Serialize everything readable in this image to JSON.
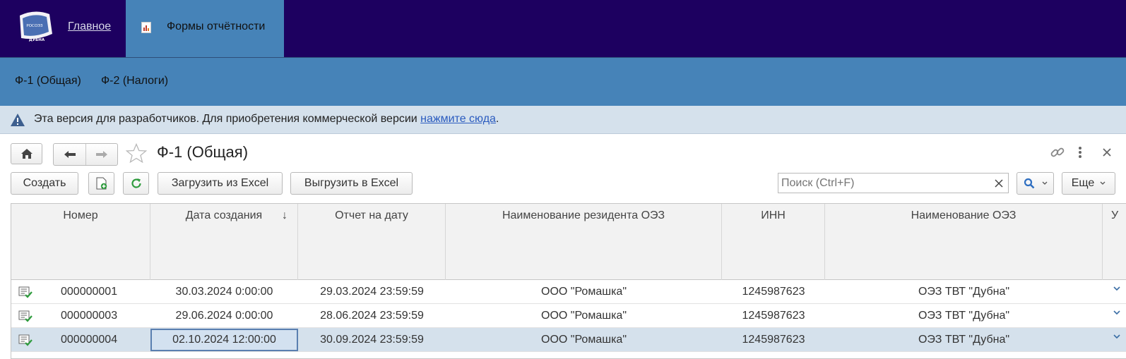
{
  "topbar": {
    "logo_alt": "РОСОЭЗ ДУБНА",
    "logo_line1": "РОСОЭЗ",
    "logo_line2": "ДУБНА",
    "home_link": "Главное",
    "active_tab": "Формы отчётности"
  },
  "sections": {
    "items": [
      {
        "label": "Ф-1 (Общая)"
      },
      {
        "label": "Ф-2 (Налоги)"
      }
    ]
  },
  "notice": {
    "text": "Эта версия для разработчиков. Для приобретения коммерческой версии ",
    "link": "нажмите сюда",
    "suffix": "."
  },
  "form": {
    "title": "Ф-1 (Общая)"
  },
  "toolbar": {
    "create": "Создать",
    "import_excel": "Загрузить из Excel",
    "export_excel": "Выгрузить в Excel",
    "more": "Еще"
  },
  "search": {
    "placeholder": "Поиск (Ctrl+F)",
    "value": ""
  },
  "table": {
    "columns": [
      "Номер",
      "Дата создания",
      "Отчет на дату",
      "Наименование резидента ОЭЗ",
      "ИНН",
      "Наименование ОЭЗ",
      "У"
    ],
    "sort_indicator": "↓",
    "rows": [
      {
        "number": "000000001",
        "created": "30.03.2024 0:00:00",
        "report_date": "29.03.2024 23:59:59",
        "resident": "ООО \"Ромашка\"",
        "inn": "1245987623",
        "zone": "ОЭЗ ТВТ \"Дубна\""
      },
      {
        "number": "000000003",
        "created": "29.06.2024 0:00:00",
        "report_date": "28.06.2024 23:59:59",
        "resident": "ООО \"Ромашка\"",
        "inn": "1245987623",
        "zone": "ОЭЗ ТВТ \"Дубна\""
      },
      {
        "number": "000000004",
        "created": "02.10.2024 12:00:00",
        "report_date": "30.09.2024 23:59:59",
        "resident": "ООО \"Ромашка\"",
        "inn": "1245987623",
        "zone": "ОЭЗ ТВТ \"Дубна\""
      }
    ]
  },
  "colors": {
    "topbar": "#1d0060",
    "accent": "#4683b8",
    "notice": "#d5e1ec",
    "selected_row": "#d5e1ec"
  }
}
